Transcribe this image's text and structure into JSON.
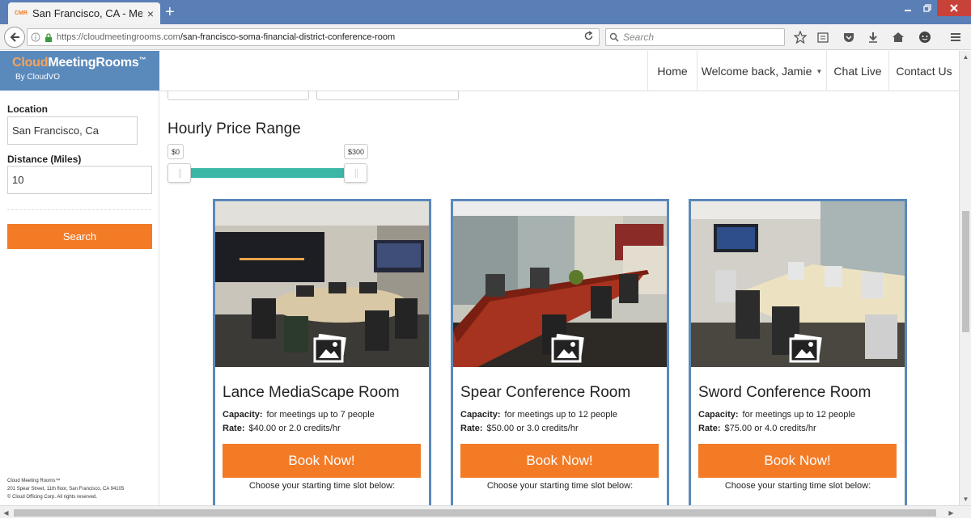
{
  "browser": {
    "tab_favicon": "CMR",
    "tab_title": "San Francisco, CA - Meeti...",
    "tab_close": "×",
    "new_tab": "+",
    "url_base": "https://cloudmeetingrooms.com",
    "url_path": "/san-francisco-soma-financial-district-conference-room",
    "search_placeholder": "Search",
    "toolbar_icons": [
      "back-icon",
      "info-icon",
      "lock-icon",
      "reload-icon",
      "search-icon",
      "bookmark-star-icon",
      "reading-list-icon",
      "pocket-icon",
      "download-icon",
      "home-icon",
      "chat-icon",
      "menu-icon"
    ]
  },
  "logo": {
    "part1": "Cloud",
    "part2": "MeetingRooms",
    "tm": "™",
    "sub": "By CloudVO"
  },
  "sidebar": {
    "location_label": "Location",
    "location_value": "San Francisco, Ca",
    "distance_label": "Distance (Miles)",
    "distance_value": "10",
    "search_label": "Search",
    "footer_lines": [
      "Cloud Meeting Rooms™",
      "201 Spear Street, 11th floor, San Francisco, CA 94105",
      "© Cloud Officing Corp. All rights reserved."
    ]
  },
  "nav": {
    "home": "Home",
    "welcome": "Welcome back, Jamie",
    "chat": "Chat Live",
    "contact": "Contact Us"
  },
  "price": {
    "title": "Hourly Price Range",
    "min_label": "$0",
    "max_label": "$300",
    "selected_min": 0,
    "selected_max": 300
  },
  "rooms": [
    {
      "name": "Lance MediaScape Room",
      "capacity_label": "Capacity:",
      "capacity": "for meetings up to 7 people",
      "rate_label": "Rate:",
      "rate": "$40.00 or 2.0 credits/hr",
      "book_label": "Book Now!",
      "choose": "Choose your starting time slot below:"
    },
    {
      "name": "Spear Conference Room",
      "capacity_label": "Capacity:",
      "capacity": "for meetings up to 12 people",
      "rate_label": "Rate:",
      "rate": "$50.00 or 3.0 credits/hr",
      "book_label": "Book Now!",
      "choose": "Choose your starting time slot below:"
    },
    {
      "name": "Sword Conference Room",
      "capacity_label": "Capacity:",
      "capacity": "for meetings up to 12 people",
      "rate_label": "Rate:",
      "rate": "$75.00 or 4.0 credits/hr",
      "book_label": "Book Now!",
      "choose": "Choose your starting time slot below:"
    }
  ],
  "colors": {
    "brand_blue": "#5a89bb",
    "accent_orange": "#f37b26",
    "slider_teal": "#3bb6a7"
  }
}
